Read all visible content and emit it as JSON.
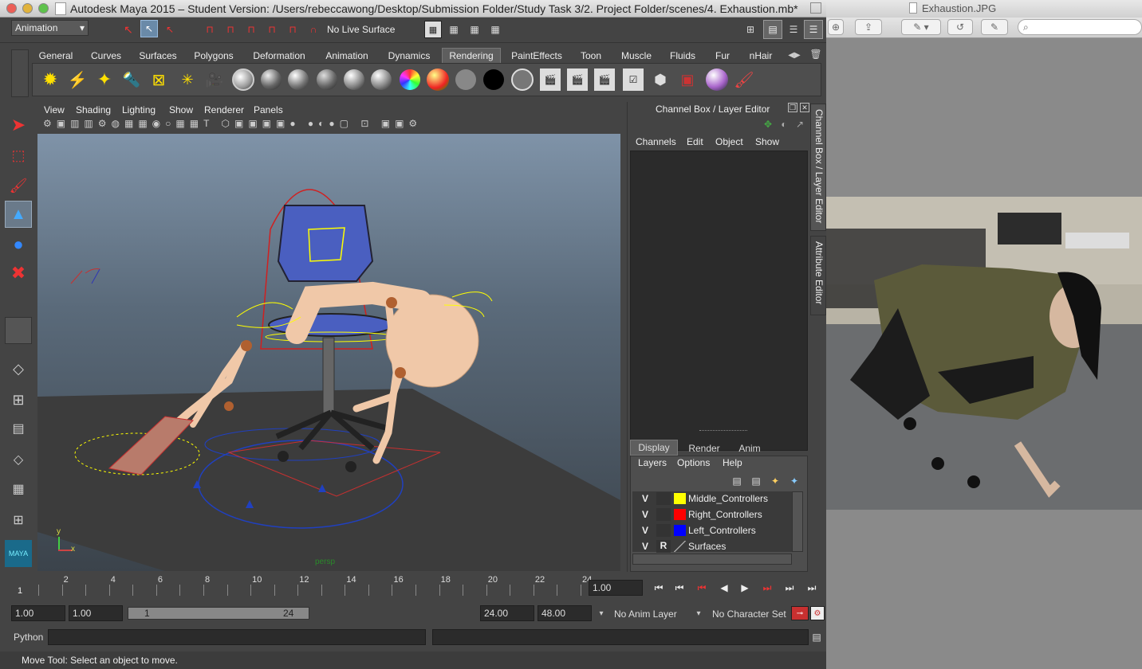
{
  "maya": {
    "window_title": "Autodesk Maya 2015 – Student Version: /Users/rebeccawong/Desktop/Submission Folder/Study Task 3/2. Project Folder/scenes/4. Exhaustion.mb*",
    "menu_set": "Animation",
    "live_surface": "No Live Surface",
    "shelf_tabs": [
      "General",
      "Curves",
      "Surfaces",
      "Polygons",
      "Deformation",
      "Animation",
      "Dynamics",
      "Rendering",
      "PaintEffects",
      "Toon",
      "Muscle",
      "Fluids",
      "Fur",
      "nHair"
    ],
    "active_shelf_tab": "Rendering",
    "viewport_menu": [
      "View",
      "Shading",
      "Lighting",
      "Show",
      "Renderer",
      "Panels"
    ],
    "camera_label": "persp",
    "axis_labels": {
      "y": "y",
      "x": "x"
    },
    "channel_box": {
      "title": "Channel Box / Layer Editor",
      "menu": [
        "Channels",
        "Edit",
        "Object",
        "Show"
      ]
    },
    "side_tabs": [
      "Channel Box / Layer Editor",
      "Attribute Editor"
    ],
    "layer_editor": {
      "tabs": [
        "Display",
        "Render",
        "Anim"
      ],
      "active_tab": "Display",
      "menu": [
        "Layers",
        "Options",
        "Help"
      ],
      "layers": [
        {
          "v": "V",
          "r": "",
          "color": "#ffff00",
          "name": "Middle_Controllers"
        },
        {
          "v": "V",
          "r": "",
          "color": "#ff0000",
          "name": "Right_Controllers"
        },
        {
          "v": "V",
          "r": "",
          "color": "#0000ff",
          "name": "Left_Controllers"
        },
        {
          "v": "V",
          "r": "R",
          "color": "",
          "name": "Surfaces"
        }
      ]
    },
    "timeline": {
      "ticks": [
        "2",
        "4",
        "6",
        "8",
        "10",
        "12",
        "14",
        "16",
        "18",
        "20",
        "22",
        "24"
      ],
      "current_frame_marker": "1",
      "current_time": "1.00"
    },
    "range": {
      "start": "1.00",
      "playback_start": "1.00",
      "slider_start": "1",
      "slider_end": "24",
      "playback_end": "24.00",
      "end": "48.00",
      "anim_layer": "No Anim Layer",
      "character_set": "No Character Set"
    },
    "command_line": {
      "language": "Python"
    },
    "help_line": "Move Tool: Select an object to move."
  },
  "preview": {
    "title": "Exhaustion.JPG"
  },
  "colors": {
    "accent_red": "#c83030",
    "controller_yellow": "#ffff00",
    "controller_blue": "#2040c0"
  }
}
